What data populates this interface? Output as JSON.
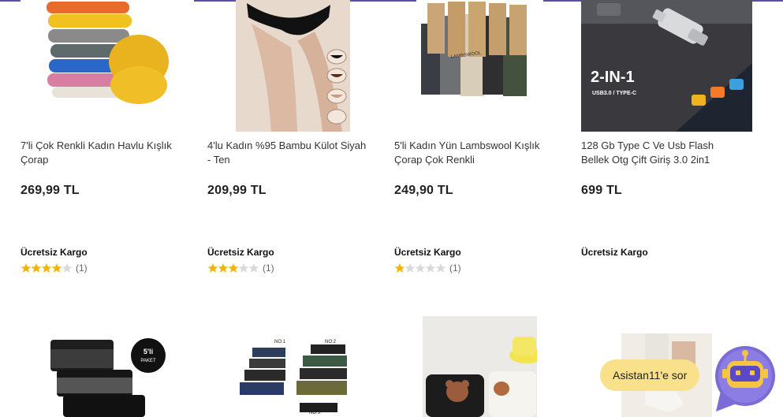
{
  "products_row1": [
    {
      "name": "7'li Çok Renkli Kadın Havlu Kışlık Çorap",
      "price": "269,99 TL",
      "cargo": "Ücretsiz Kargo",
      "stars": 4,
      "reviews": "(1)"
    },
    {
      "name": "4'lu Kadın %95 Bambu Külot Siyah - Ten",
      "price": "209,99 TL",
      "cargo": "Ücretsiz Kargo",
      "stars": 3,
      "reviews": "(1)"
    },
    {
      "name": "5'li Kadın Yün Lambswool Kışlık Çorap Çok Renkli",
      "price": "249,90 TL",
      "cargo": "Ücretsiz Kargo",
      "stars": 1,
      "reviews": "(1)"
    },
    {
      "name": "128 Gb Type C Ve Usb Flash Bellek Otg Çift Giriş 3.0 2in1",
      "price": "699 TL",
      "cargo": "Ücretsiz Kargo"
    }
  ],
  "image_text": {
    "usb_badge": "2-IN-1",
    "usb_sub": "USB3.0 / TYPE-C",
    "lambswool": "LAMBSWOOL",
    "pack_badge_1": "5'li",
    "pack_badge_2": "PAKET",
    "no1": "NO:1",
    "no2": "NO:2",
    "no3": "NO:3"
  },
  "assistant": {
    "label": "Asistan11'e sor"
  },
  "colors": {
    "accent": "#5b4ea6",
    "star_filled": "#f5b301",
    "star_empty": "#d9d9d9",
    "assistant_bg": "#f9e08b"
  }
}
